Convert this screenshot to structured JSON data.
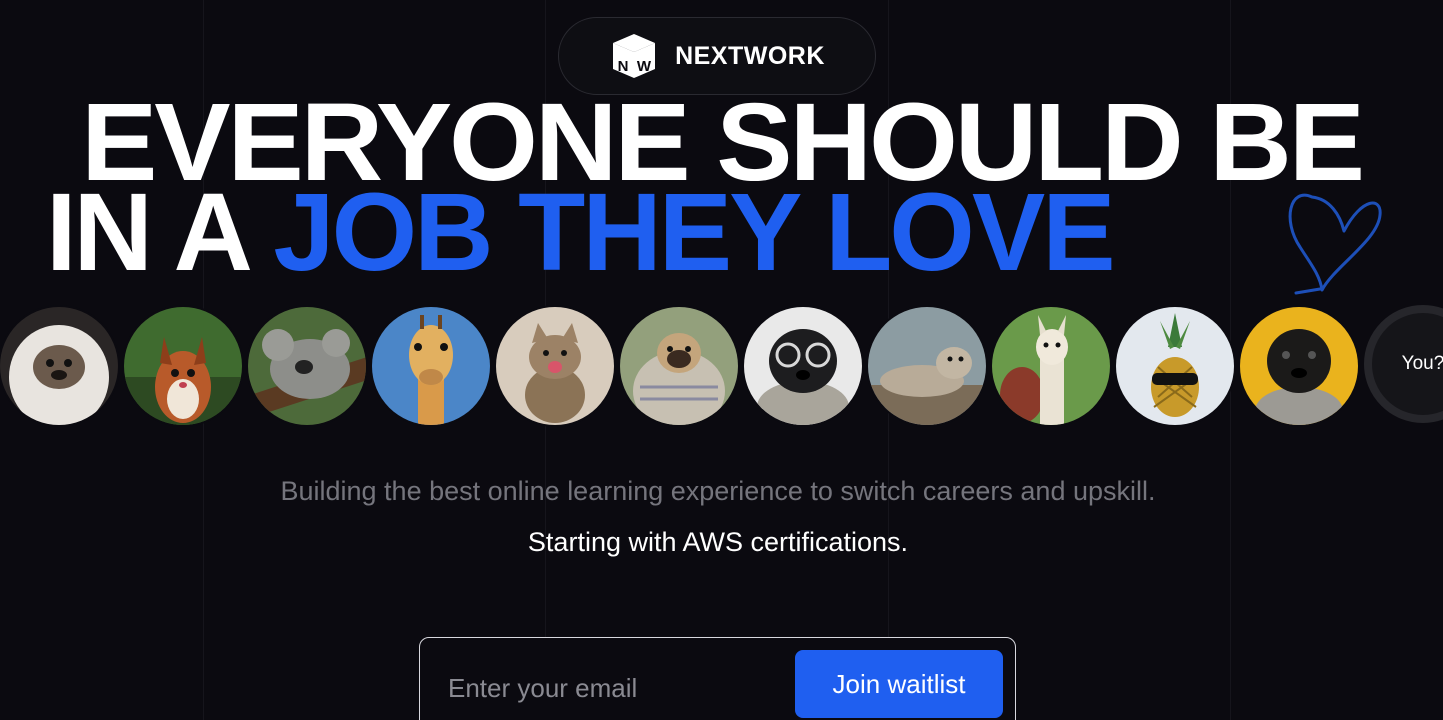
{
  "brand": {
    "name": "NEXTWORK",
    "logo_letters": [
      "N",
      "W"
    ]
  },
  "hero": {
    "line1": "EVERYONE SHOULD BE",
    "line2_prefix": "IN A ",
    "line2_highlight": "JOB THEY LOVE",
    "highlight_color": "#1f5ff0",
    "decoration_icon": "heart-outline-icon"
  },
  "avatars": {
    "items": [
      {
        "name": "avatar-fluffy-dog"
      },
      {
        "name": "avatar-squirrel"
      },
      {
        "name": "avatar-koala"
      },
      {
        "name": "avatar-giraffe"
      },
      {
        "name": "avatar-kitten"
      },
      {
        "name": "avatar-pug-blanket"
      },
      {
        "name": "avatar-pug-glasses"
      },
      {
        "name": "avatar-seal"
      },
      {
        "name": "avatar-alpaca"
      },
      {
        "name": "avatar-pineapple"
      },
      {
        "name": "avatar-pug-yellow"
      }
    ],
    "you_label": "You?"
  },
  "subtitle": "Building the best online learning experience to switch careers and upskill.",
  "tagline": "Starting with AWS certifications.",
  "waitlist": {
    "placeholder": "Enter your email",
    "button_label": "Join waitlist",
    "accent_color": "#1f5ff0"
  }
}
